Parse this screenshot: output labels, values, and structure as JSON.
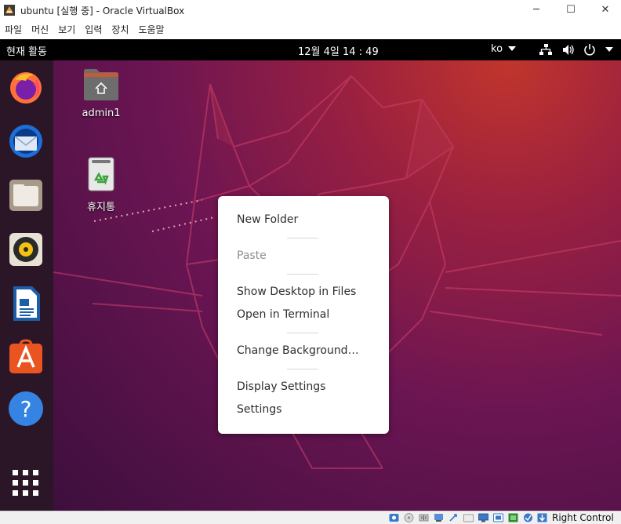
{
  "window": {
    "title": "ubuntu [실행 중] - Oracle VirtualBox",
    "minimize": "─",
    "maximize": "☐",
    "close": "✕"
  },
  "menubar": {
    "items": [
      "파일",
      "머신",
      "보기",
      "입력",
      "장치",
      "도움말"
    ]
  },
  "topbar": {
    "activities": "현재 활동",
    "clock": "12월 4일  14 : 49",
    "language": "ko"
  },
  "dock": {
    "items": [
      "firefox-icon",
      "thunderbird-icon",
      "files-icon",
      "rhythmbox-icon",
      "libreoffice-writer-icon",
      "software-center-icon",
      "help-icon",
      "show-applications-icon"
    ]
  },
  "desktop": {
    "icons": [
      {
        "label": "admin1",
        "icon": "home-folder-icon"
      },
      {
        "label": "휴지통",
        "icon": "trash-icon"
      }
    ]
  },
  "context_menu": {
    "new_folder": "New Folder",
    "paste": "Paste",
    "show_desktop_in_files": "Show Desktop in Files",
    "open_in_terminal": "Open in Terminal",
    "change_background": "Change Background…",
    "display_settings": "Display Settings",
    "settings": "Settings"
  },
  "statusbar": {
    "host_key": "Right Control"
  }
}
